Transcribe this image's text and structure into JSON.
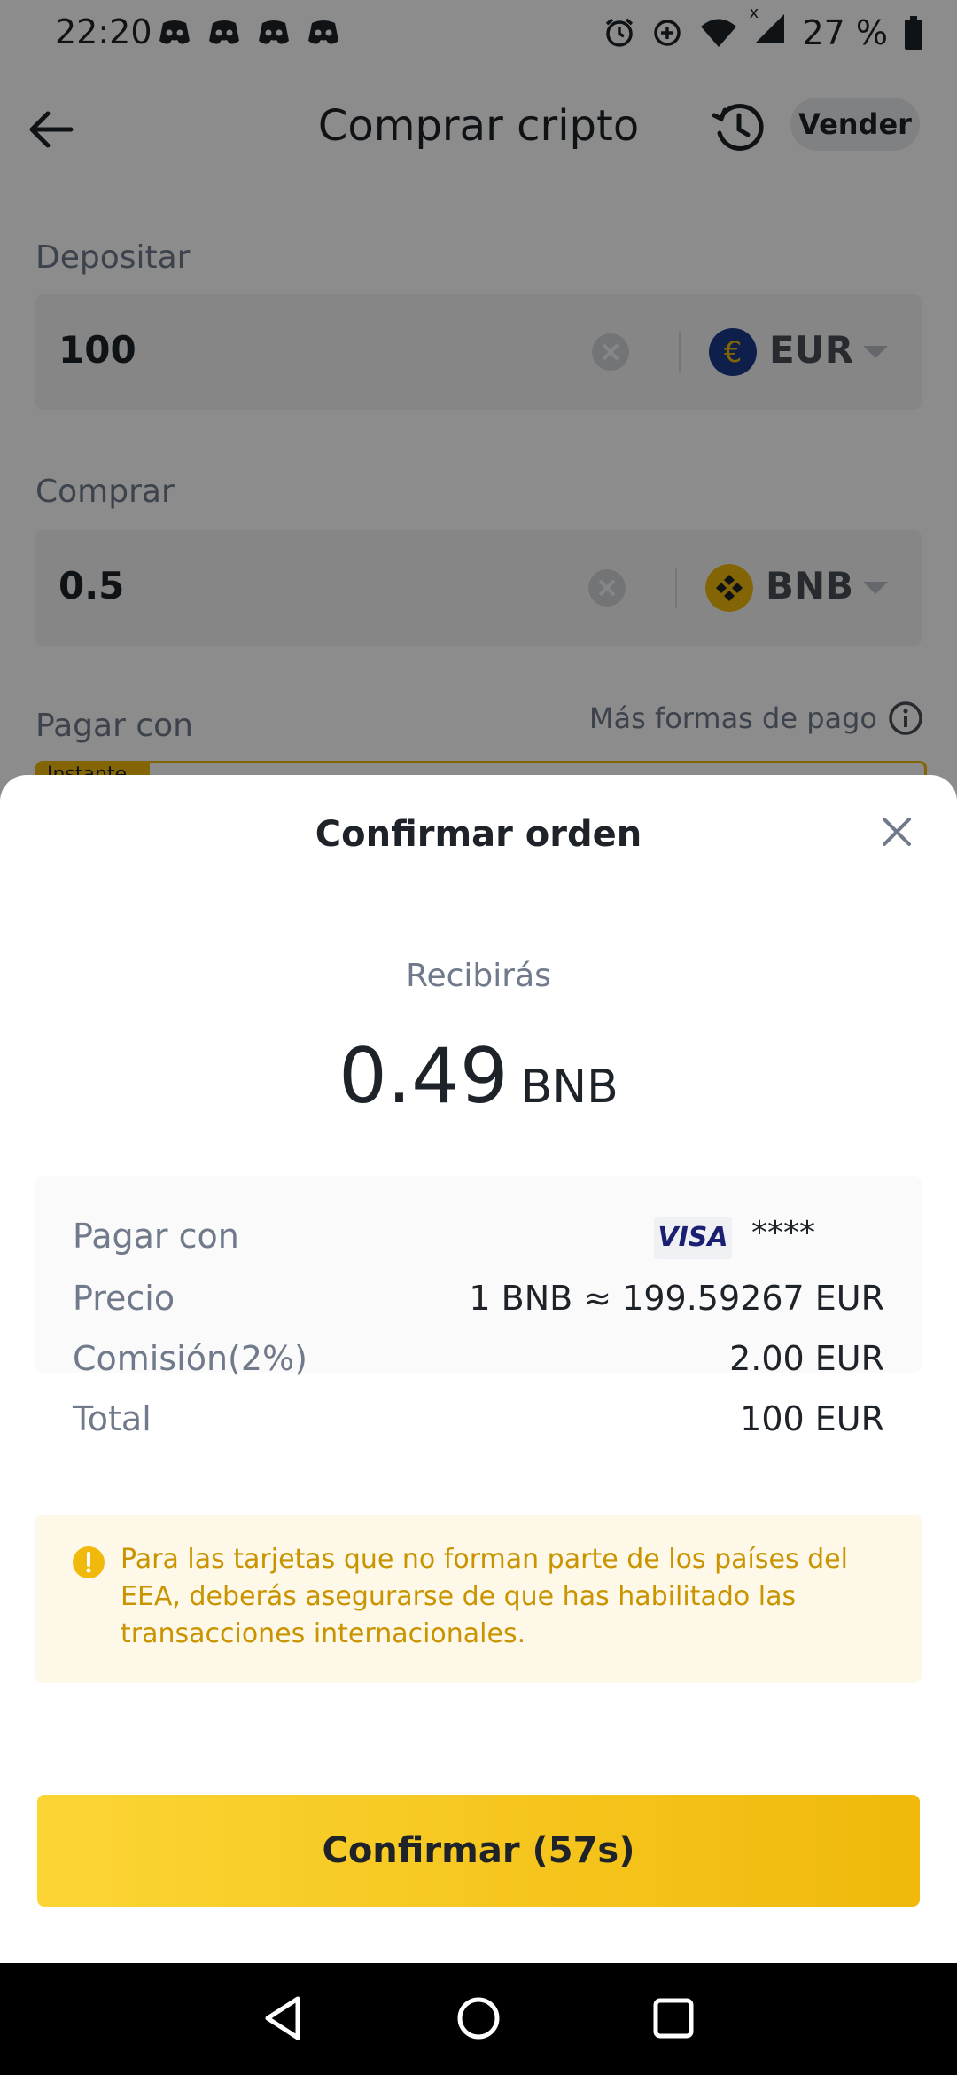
{
  "status_bar": {
    "time": "22:20",
    "notification_icons": [
      "discord-icon",
      "discord-icon",
      "discord-icon",
      "discord-icon"
    ],
    "right_icons": [
      "alarm-icon",
      "data-saver-icon",
      "wifi-icon",
      "signal-icon",
      "battery-icon"
    ],
    "signal_marker": "x",
    "battery": "27 %"
  },
  "header": {
    "title": "Comprar cripto",
    "back_icon": "arrow-left-icon",
    "history_icon": "history-icon",
    "sell_label": "Vender"
  },
  "deposit": {
    "label": "Depositar",
    "value": "100",
    "currency": "EUR",
    "currency_symbol": "€",
    "currency_color": "#1d3a8a"
  },
  "buy": {
    "label": "Comprar",
    "value": "0.5",
    "currency": "BNB",
    "coin_color": "#f0b90b"
  },
  "pay_with": {
    "label": "Pagar con",
    "more_options": "Más formas de pago",
    "badge": "Instante"
  },
  "sheet": {
    "title": "Confirmar orden",
    "receive_label": "Recibirás",
    "receive_amount": "0.49",
    "receive_unit": "BNB",
    "rows": [
      {
        "label": "Pagar con",
        "card_brand": "VISA",
        "value": "****"
      },
      {
        "label": "Precio",
        "value": "1 BNB ≈ 199.59267 EUR"
      },
      {
        "label": "Comisión(2%)",
        "value": "2.00 EUR"
      },
      {
        "label": "Total",
        "value": "100 EUR"
      }
    ],
    "notice": "Para las tarjetas que no forman parte de los países del EEA, deberás asegurarse de que has habilitado las transacciones internacionales.",
    "confirm_label": "Confirmar (57s)"
  },
  "colors": {
    "accent": "#f0b90b",
    "notice_text": "#c99400",
    "notice_bg": "#fdf8e8"
  },
  "nav": {
    "back_icon": "nav-back-icon",
    "home_icon": "nav-home-icon",
    "recents_icon": "nav-recents-icon"
  }
}
